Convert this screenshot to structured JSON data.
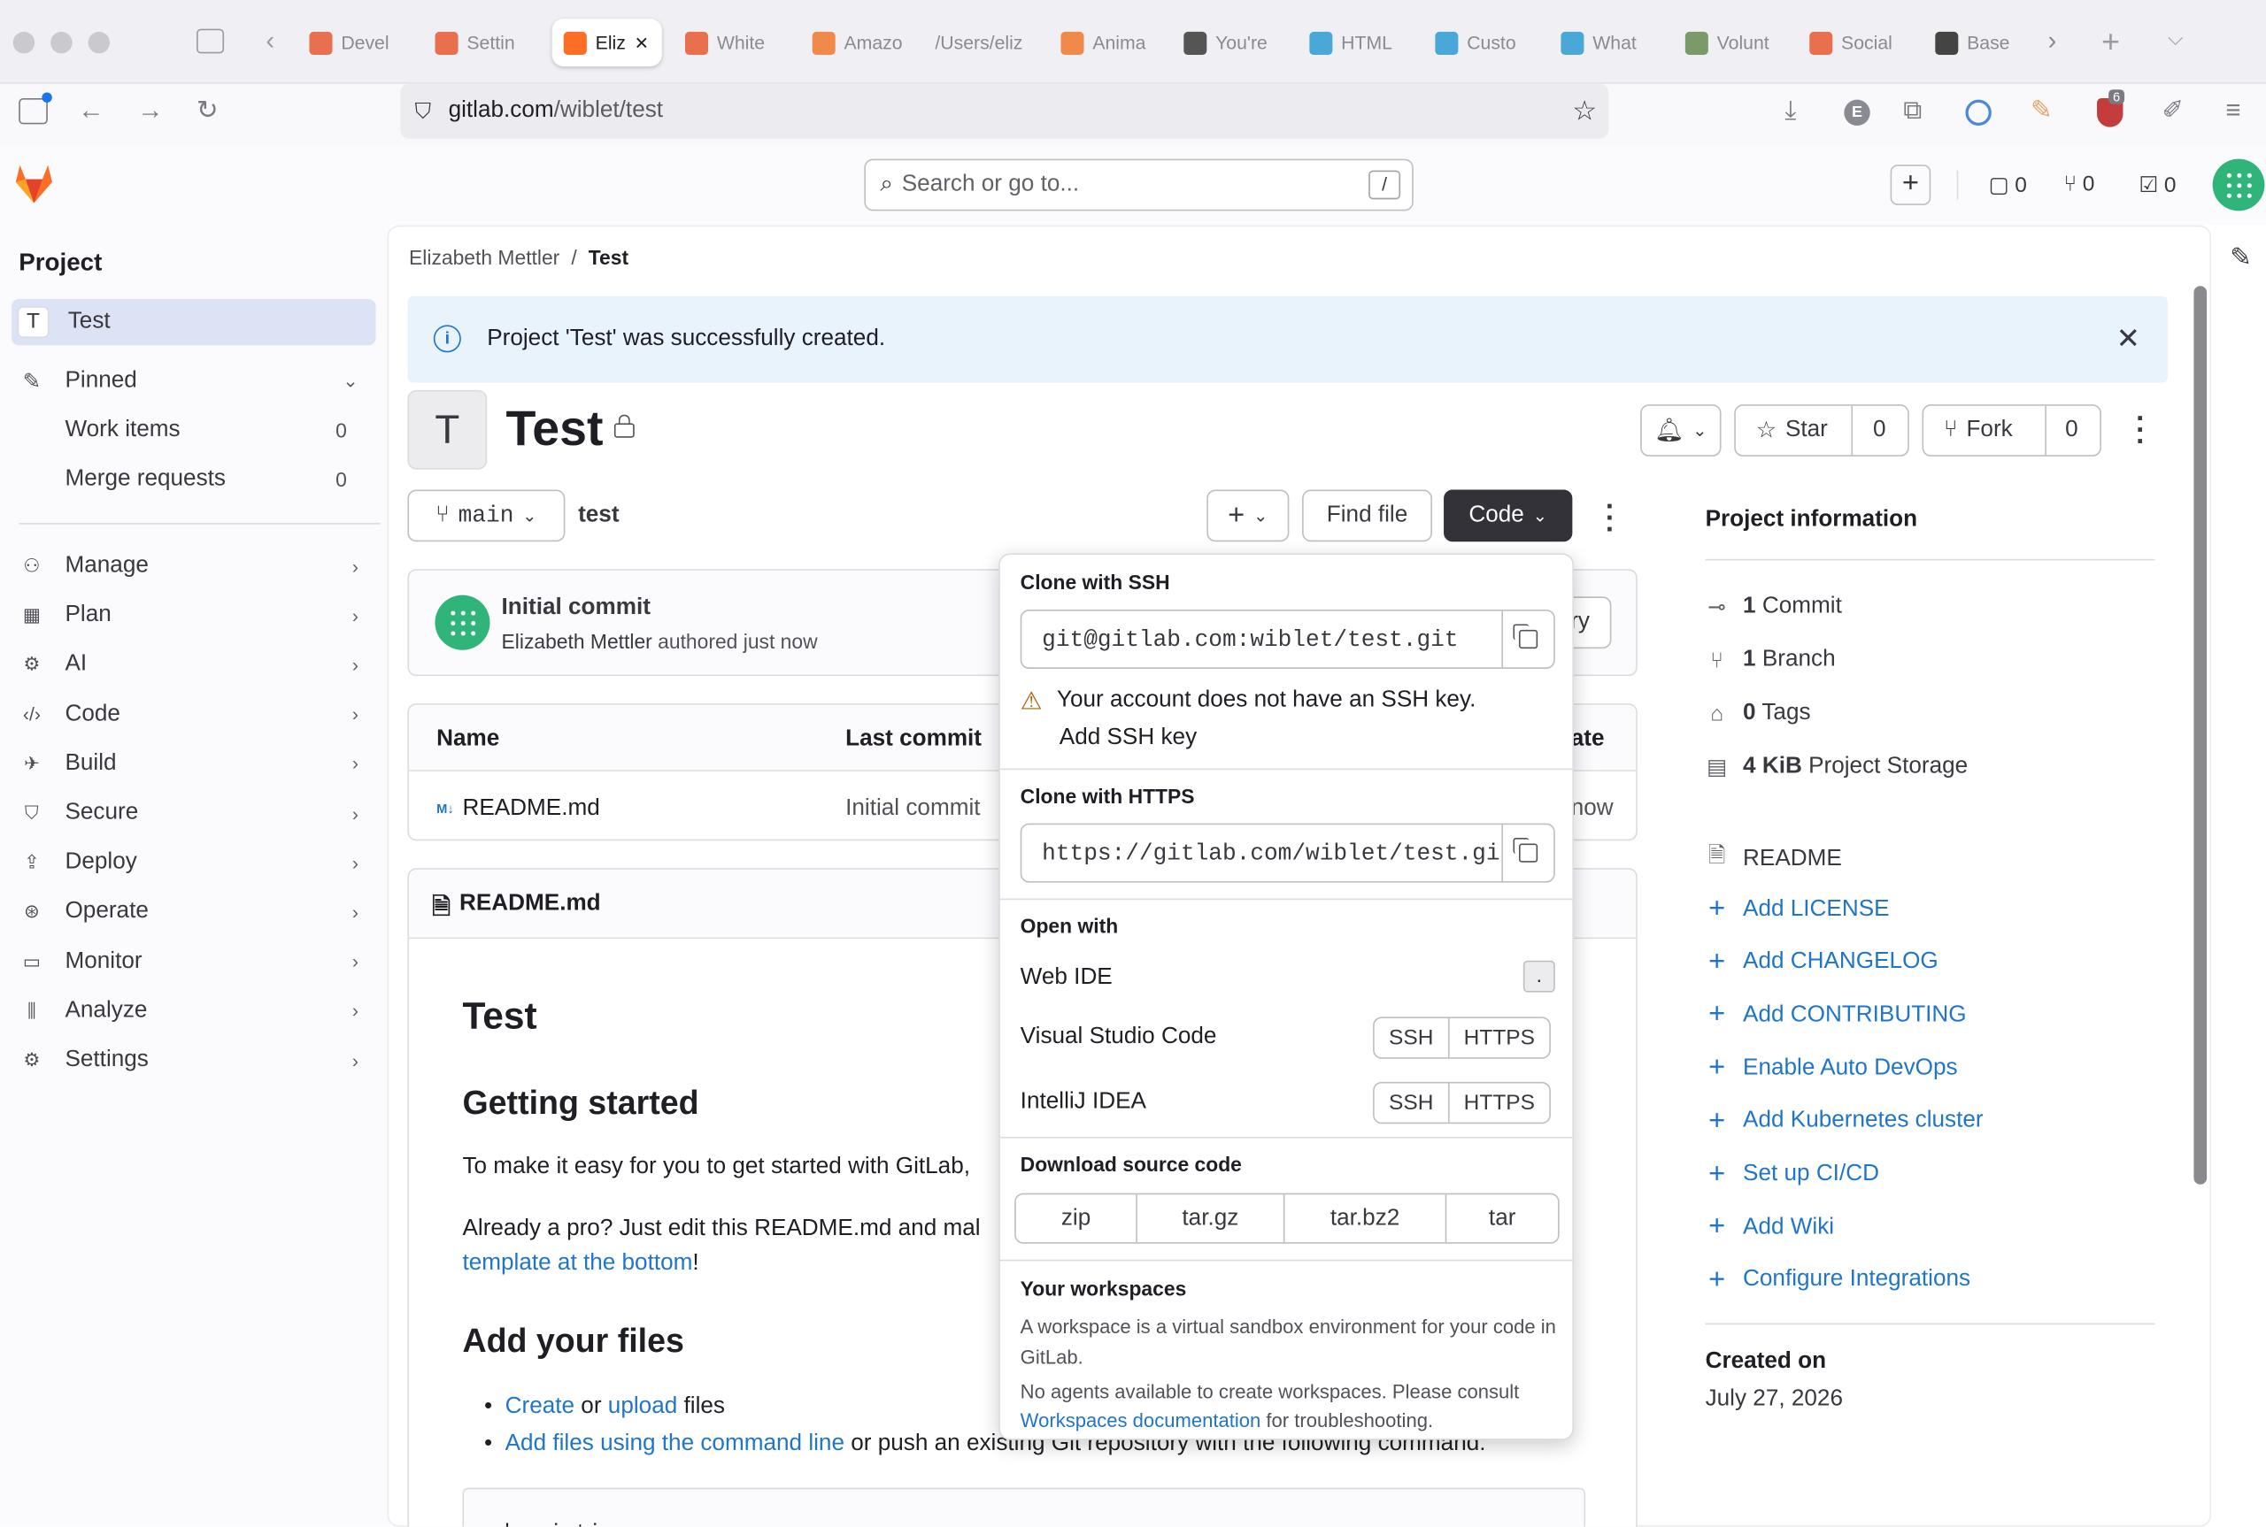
{
  "browser": {
    "tabs": [
      {
        "label": "Devel",
        "color": "#e8704f"
      },
      {
        "label": "Settin",
        "color": "#e8704f"
      },
      {
        "label": "Eliz",
        "color": "#fc6d26"
      },
      {
        "label": "White",
        "color": "#e8704f"
      },
      {
        "label": "Amazo",
        "color": "#f08a4b"
      },
      {
        "label": "/Users/eliz",
        "color": "#ffffff"
      },
      {
        "label": "Anima",
        "color": "#f08a4b"
      },
      {
        "label": "You're",
        "color": "#555555"
      },
      {
        "label": "HTML",
        "color": "#4aa8d8"
      },
      {
        "label": "Custo",
        "color": "#4aa8d8"
      },
      {
        "label": "What",
        "color": "#4aa8d8"
      },
      {
        "label": "Volunt",
        "color": "#7a9a6a"
      },
      {
        "label": "Social",
        "color": "#e8704f"
      },
      {
        "label": "Base",
        "color": "#444444"
      }
    ],
    "url_host": "gitlab.com",
    "url_path": "/wiblet/test",
    "ext_badge": "6"
  },
  "header": {
    "search_placeholder": "Search or go to...",
    "search_shortcut": "/",
    "issues_count": "0",
    "mr_count": "0",
    "todo_count": "0"
  },
  "sidebar": {
    "section": "Project",
    "project_initial": "T",
    "project_name": "Test",
    "pinned": "Pinned",
    "pinned_items": [
      {
        "label": "Work items",
        "count": "0"
      },
      {
        "label": "Merge requests",
        "count": "0"
      }
    ],
    "items": [
      "Manage",
      "Plan",
      "AI",
      "Code",
      "Build",
      "Secure",
      "Deploy",
      "Operate",
      "Monitor",
      "Analyze",
      "Settings"
    ]
  },
  "breadcrumb": {
    "owner": "Elizabeth Mettler",
    "sep": "/",
    "project": "Test"
  },
  "alert": {
    "message": "Project 'Test' was successfully created."
  },
  "project": {
    "initial": "T",
    "title": "Test",
    "star_label": "Star",
    "star_count": "0",
    "fork_label": "Fork",
    "fork_count": "0"
  },
  "repo": {
    "branch": "main",
    "path": "test",
    "find_file": "Find file",
    "code_label": "Code",
    "commit_title": "Initial commit",
    "commit_author": "Elizabeth Mettler",
    "commit_meta": "authored just now",
    "history_frag": "ry",
    "table_headers": {
      "name": "Name",
      "last_commit": "Last commit",
      "date_frag": "ate"
    },
    "files": [
      {
        "name": "README.md",
        "commit": "Initial commit",
        "date_frag": "now"
      }
    ]
  },
  "readme": {
    "header": "README.md",
    "h1": "Test",
    "h2_start": "Getting started",
    "p1": "To make it easy for you to get started with GitLab,",
    "p2_a": "Already a pro? Just edit this README.md and mal",
    "p2_link": "template at the bottom",
    "p2_end": "!",
    "h2_files": "Add your files",
    "li1_link1": "Create",
    "li1_or": " or ",
    "li1_link2": "upload",
    "li1_end": " files",
    "li2_link": "Add files using the command line",
    "li2_end": " or push an existing Git repository with the following command:",
    "code_frag": "cd existing_repo"
  },
  "clone_menu": {
    "ssh_title": "Clone with SSH",
    "ssh_url": "git@gitlab.com:wiblet/test.git",
    "ssh_warning": "Your account does not have an SSH key.",
    "add_ssh_key": "Add SSH key",
    "https_title": "Clone with HTTPS",
    "https_url": "https://gitlab.com/wiblet/test.git",
    "open_with": "Open with",
    "web_ide": "Web IDE",
    "web_ide_key": ".",
    "vscode": "Visual Studio Code",
    "intellij": "IntelliJ IDEA",
    "ssh": "SSH",
    "https": "HTTPS",
    "download_title": "Download source code",
    "formats": [
      "zip",
      "tar.gz",
      "tar.bz2",
      "tar"
    ],
    "workspaces_title": "Your workspaces",
    "workspaces_desc": "A workspace is a virtual sandbox environment for your code in GitLab.",
    "workspaces_note_a": "No agents available to create workspaces. Please consult ",
    "workspaces_note_link": "Workspaces documentation",
    "workspaces_note_b": " for troubleshooting."
  },
  "project_info": {
    "title": "Project information",
    "commits_n": "1",
    "commits_l": "Commit",
    "branches_n": "1",
    "branches_l": "Branch",
    "tags_n": "0",
    "tags_l": "Tags",
    "storage_n": "4 KiB",
    "storage_l": "Project Storage",
    "readme": "README",
    "add_links": [
      "Add LICENSE",
      "Add CHANGELOG",
      "Add CONTRIBUTING",
      "Enable Auto DevOps",
      "Add Kubernetes cluster",
      "Set up CI/CD",
      "Add Wiki",
      "Configure Integrations"
    ],
    "created_label": "Created on",
    "created_date": "July 27, 2026"
  }
}
